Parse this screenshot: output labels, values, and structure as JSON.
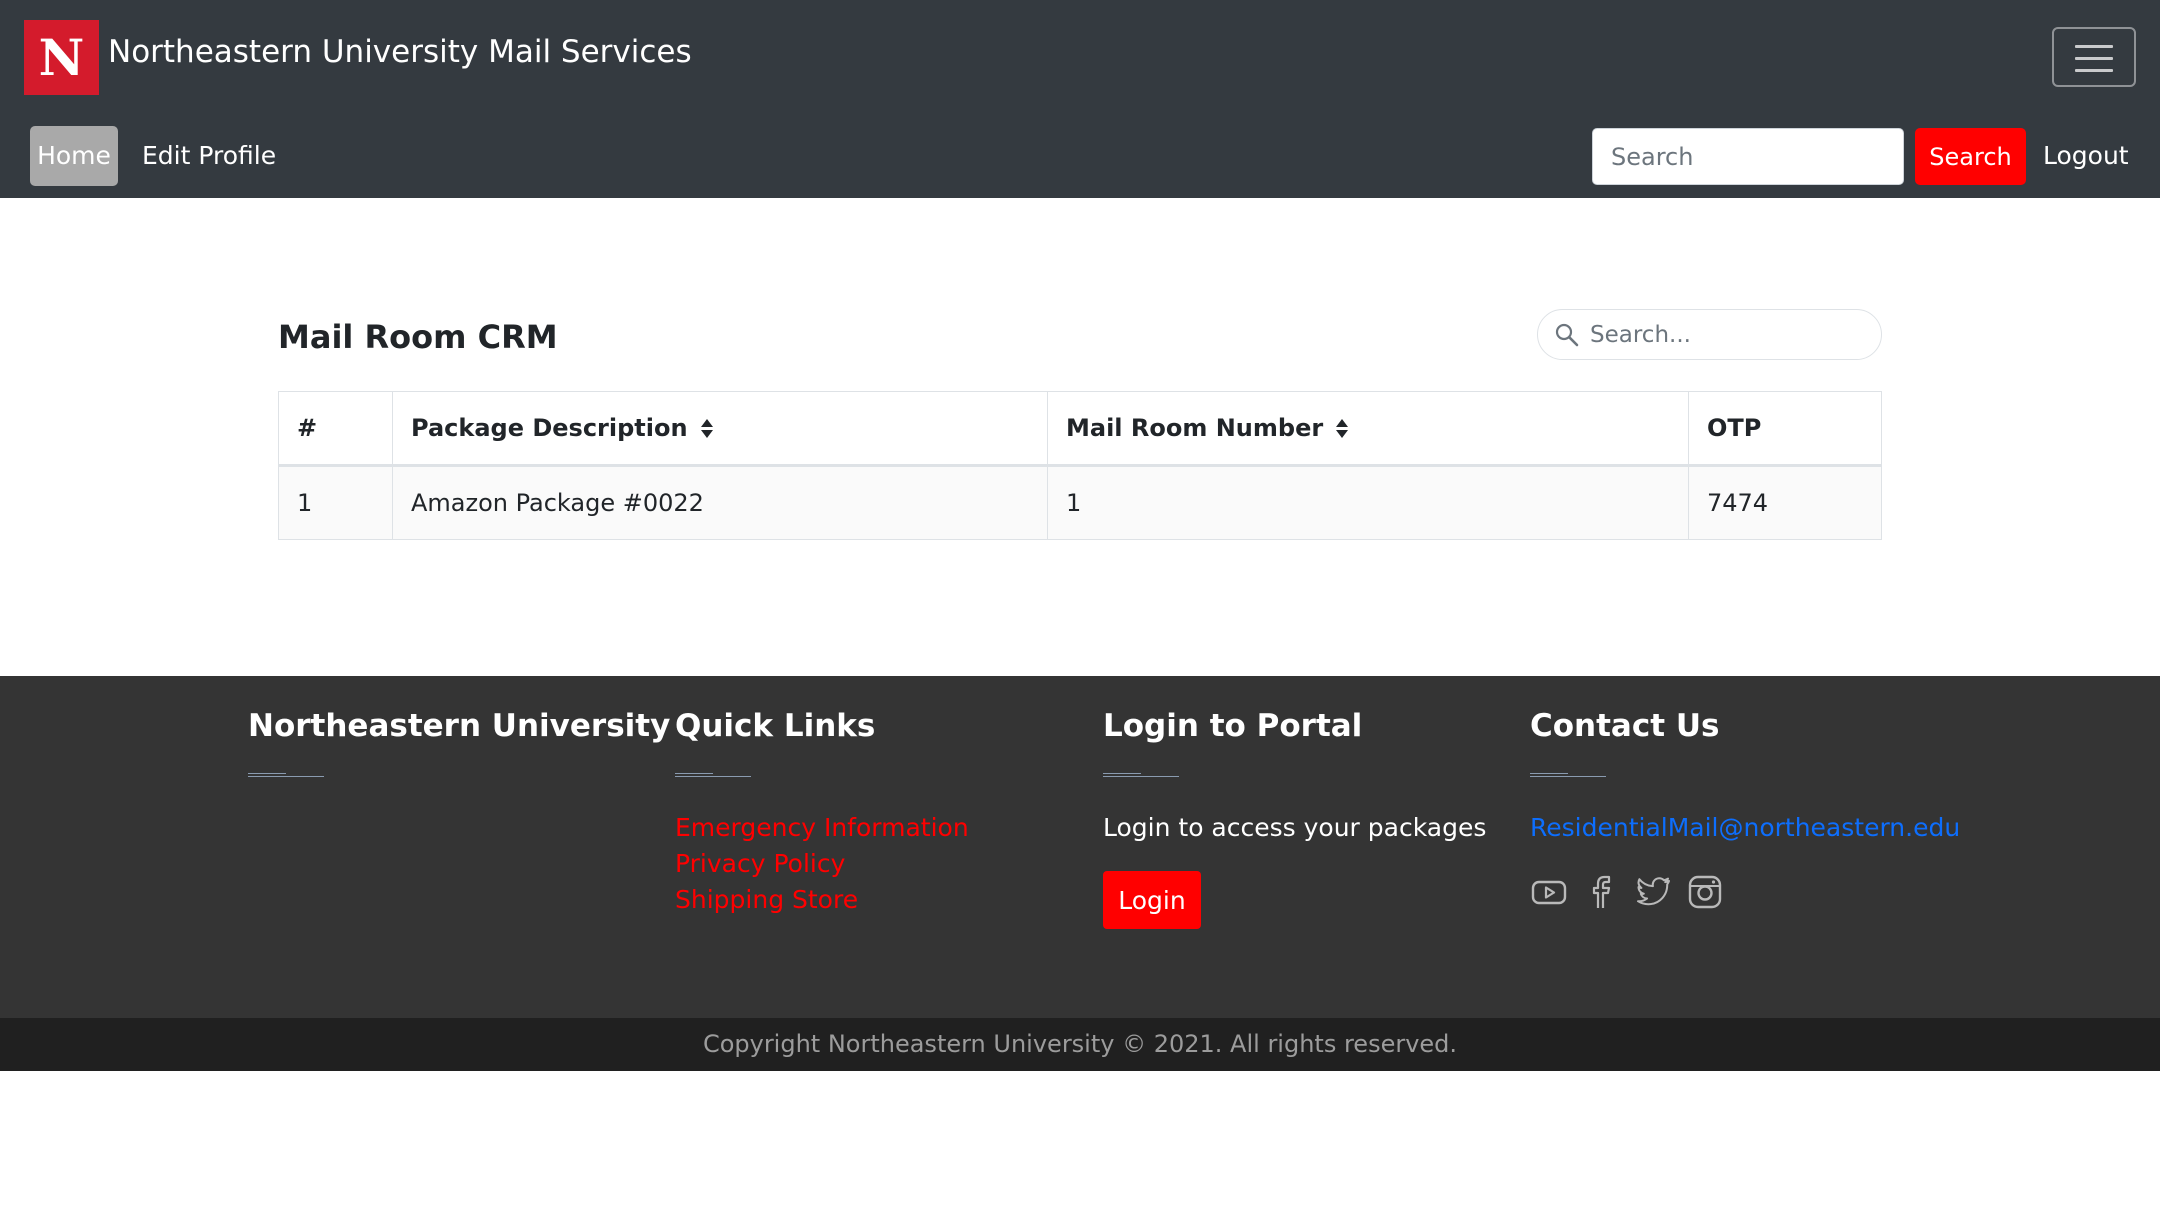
{
  "brand": {
    "logo_letter": "N",
    "name": "Northeastern University Mail Services",
    "accent_color": "#d41b2c"
  },
  "navbar": {
    "menu_icon": "hamburger-menu-icon",
    "links": {
      "home": "Home",
      "edit_profile": "Edit Profile",
      "logout": "Logout"
    },
    "search": {
      "placeholder": "Search",
      "button_label": "Search",
      "button_color": "#ff0000"
    },
    "background": "#343a40"
  },
  "main": {
    "title_regular": "Mail Room ",
    "title_bold": "CRM",
    "table_search": {
      "placeholder": "Search...",
      "icon": "magnifier-icon"
    },
    "table": {
      "columns": [
        "#",
        "Package Description",
        "Mail Room Number",
        "OTP"
      ],
      "sortable": [
        false,
        true,
        true,
        false
      ],
      "rows": [
        [
          "1",
          "Amazon Package #0022",
          "1",
          "7474"
        ]
      ]
    }
  },
  "footer": {
    "columns": {
      "university": {
        "heading": "Northeastern University"
      },
      "quick_links": {
        "heading": "Quick Links",
        "links": [
          "Emergency Information",
          "Privacy Policy",
          "Shipping Store"
        ]
      },
      "portal": {
        "heading": "Login to Portal",
        "text": "Login to access your packages",
        "button_label": "Login"
      },
      "contact": {
        "heading": "Contact Us",
        "email": "ResidentialMail@northeastern.edu",
        "social_icons": [
          "youtube-icon",
          "facebook-icon",
          "twitter-icon",
          "instagram-icon"
        ]
      }
    },
    "copyright": "Copyright Northeastern University © 2021. All rights reserved."
  }
}
